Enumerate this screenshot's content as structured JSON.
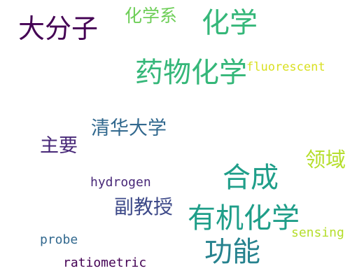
{
  "colors": {
    "background": "#ffffff",
    "dark_purple": "#440154",
    "purple": "#482878",
    "blue_purple": "#3e4a89",
    "blue": "#31688e",
    "teal_blue": "#26828e",
    "teal": "#1f9e89",
    "green": "#35b779",
    "light_green": "#6ece58",
    "yellow_green": "#b5de2b",
    "yellow": "#d9e021"
  },
  "words": [
    {
      "text": "大分子",
      "color": "#440154"
    },
    {
      "text": "化学系",
      "color": "#6ece58"
    },
    {
      "text": "化学",
      "color": "#35b779"
    },
    {
      "text": "药物化学",
      "color": "#35b779"
    },
    {
      "text": "fluorescent",
      "color": "#d9e021"
    },
    {
      "text": "清华大学",
      "color": "#31688e"
    },
    {
      "text": "主要",
      "color": "#482878"
    },
    {
      "text": "领域",
      "color": "#b5de2b"
    },
    {
      "text": "合成",
      "color": "#1f9e89"
    },
    {
      "text": "hydrogen",
      "color": "#482878"
    },
    {
      "text": "副教授",
      "color": "#3e4a89"
    },
    {
      "text": "有机化学",
      "color": "#1f9e89"
    },
    {
      "text": "sensing",
      "color": "#b5de2b"
    },
    {
      "text": "probe",
      "color": "#31688e"
    },
    {
      "text": "功能",
      "color": "#26828e"
    },
    {
      "text": "ratiometric",
      "color": "#440154"
    }
  ]
}
